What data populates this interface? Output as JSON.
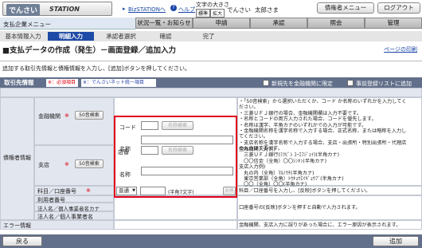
{
  "header": {
    "logo_main": "でんさい",
    "logo_sub": "STATION",
    "link_biz": "BizSTATIONへ",
    "link_help": "ヘルプ",
    "font_size_label": "文字の大きさ",
    "font_standard": "標準",
    "font_large": "拡大",
    "user_company": "でんさい",
    "user_name": "太郎さま",
    "creditor_menu": "債権者メニュー",
    "logout": "ログアウト"
  },
  "menu": {
    "system_name": "支払企業メニュー",
    "items": [
      "状況一覧・お知らせ",
      "申請",
      "承認",
      "照会",
      "管理"
    ]
  },
  "steps": [
    "基本情報入力",
    "明細入力",
    "承認者選択",
    "確認",
    "完了"
  ],
  "page": {
    "title": "■支払データの作成（発生）－画面登録／追加入力",
    "print_link": "ページの印刷",
    "hint": "追加する取引先情報と債権情報を入力し、[追加]ボタンを押してください。"
  },
  "section": {
    "title": "取引先情報",
    "legend_required": "※：必須項目",
    "legend_net": "※：でんさいネット統一項目",
    "chk_new_bank": "新規先を金融機関に限定",
    "chk_register": "事前登録リストに追加"
  },
  "form": {
    "group_label": "債権者情報",
    "bank_label": "金融機関",
    "branch_label": "支店",
    "kana_search": "50音検索",
    "code_label": "コード",
    "name_label": "名称",
    "branch_code_label": "店番",
    "name_search": "名称検索",
    "account_label": "科目／口座番号",
    "account_type": "普通",
    "account_note": "(半角7文字)",
    "ref_button": "反映",
    "user_no": "利用者番号",
    "corp_name_kana": "法人名／個人事業者名カナ",
    "corp_name": "法人名／個人事業者名",
    "error_label": "エラー情報"
  },
  "notes": {
    "bank": [
      "・「50音検索」から選択いただくか、コード か名称のいずれかを入力してく",
      "ださい。",
      "・三菱ＵＦＪ銀行の場合、金融機関欄は入力不要です。",
      "・名称とコードの両方入力された場合、コードを優先します。",
      "・名称は漢字、半角カナのいずれかでの入力が可能です。",
      "・金融機関名称を漢字名称で入力する場合、正式名称、または略称を入力し",
      "てください。",
      "・支店名称を漢字名称で入力する場合、支店・出張所・特別出張所・代理店",
      "の入力は不要です。"
    ],
    "examples": [
      "金融機関入力例)",
      "　三菱ＵＦＪ銀行(ﾐﾂﾋﾞｼ ﾕｰｴﾌｼﾞｪｲ)(半角カナ)",
      "　〇〇信金（全角）〇〇ｼﾝｷﾝ(半角カナ)",
      "支店入力例)",
      "　丸の内（全角）ﾏﾙﾉｳﾁ(半角カナ)",
      "　東京営業部（全角）ﾄｳｷｮｳｴｲｷﾞｮｳﾌﾞ(半角カナ)",
      "　〇〇（全角）〇〇(半角カナ)"
    ],
    "account": "科目／口座番号を入力し、[反映]ボタンを押してください。",
    "corp": "口座番号の[反映]ボタンを押すと自動で入力されます。",
    "error": "金融機関、支店入力に誤りがあった場合に、エラー原因が表示されます。"
  },
  "footer": {
    "back": "戻る",
    "add": "追加"
  }
}
